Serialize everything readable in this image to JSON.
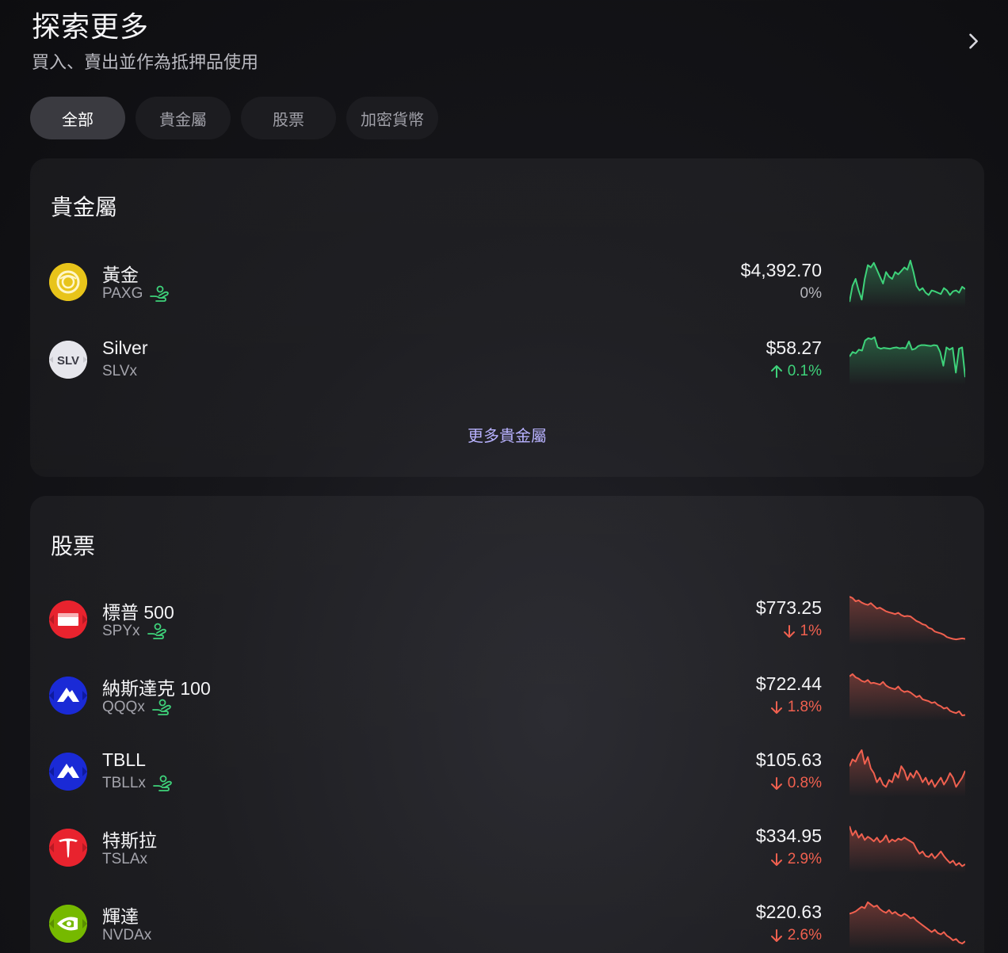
{
  "header": {
    "title": "探索更多",
    "subtitle": "買入、賣出並作為抵押品使用"
  },
  "tabs": [
    {
      "label": "全部",
      "active": true
    },
    {
      "label": "貴金屬",
      "active": false
    },
    {
      "label": "股票",
      "active": false
    },
    {
      "label": "加密貨幣",
      "active": false
    }
  ],
  "metals": {
    "title": "貴金屬",
    "more_label": "更多貴金屬",
    "items": [
      {
        "name": "黃金",
        "ticker": "PAXG",
        "lendable": true,
        "price": "$4,392.70",
        "change": "0%",
        "direction": "flat",
        "logo": "gold-coin-icon",
        "spark": [
          0.05,
          0.4,
          0.55,
          0.3,
          0.1,
          0.55,
          0.85,
          0.8,
          0.9,
          0.75,
          0.6,
          0.45,
          0.7,
          0.6,
          0.55,
          0.7,
          0.65,
          0.72,
          0.8,
          0.75,
          0.95,
          0.7,
          0.4,
          0.3,
          0.35,
          0.25,
          0.2,
          0.3,
          0.28,
          0.25,
          0.22,
          0.35,
          0.3,
          0.2,
          0.28,
          0.3,
          0.25,
          0.38,
          0.33
        ]
      },
      {
        "name": "Silver",
        "ticker": "SLVx",
        "lendable": false,
        "price": "$58.27",
        "change": "0.1%",
        "direction": "up",
        "logo": "slv-icon",
        "spark": [
          0.55,
          0.65,
          0.62,
          0.7,
          0.68,
          0.9,
          0.95,
          0.93,
          0.97,
          0.75,
          0.72,
          0.74,
          0.73,
          0.72,
          0.74,
          0.75,
          0.73,
          0.74,
          0.73,
          0.88,
          0.7,
          0.72,
          0.78,
          0.8,
          0.8,
          0.79,
          0.78,
          0.8,
          0.79,
          0.65,
          0.35,
          0.75,
          0.7,
          0.74,
          0.2,
          0.72,
          0.75,
          0.1
        ]
      }
    ]
  },
  "stocks": {
    "title": "股票",
    "items": [
      {
        "name": "標普 500",
        "ticker": "SPYx",
        "lendable": true,
        "price": "$773.25",
        "change": "1%",
        "direction": "down",
        "logo": "sp500-icon",
        "spark": [
          0.98,
          0.95,
          0.88,
          0.9,
          0.85,
          0.82,
          0.8,
          0.84,
          0.78,
          0.72,
          0.74,
          0.7,
          0.66,
          0.64,
          0.62,
          0.6,
          0.63,
          0.58,
          0.55,
          0.56,
          0.55,
          0.5,
          0.45,
          0.42,
          0.38,
          0.36,
          0.3,
          0.28,
          0.22,
          0.2,
          0.18,
          0.15,
          0.1,
          0.08,
          0.06,
          0.05,
          0.06,
          0.07,
          0.06
        ]
      },
      {
        "name": "納斯達克 100",
        "ticker": "QQQx",
        "lendable": true,
        "price": "$722.44",
        "change": "1.8%",
        "direction": "down",
        "logo": "nasdaq-icon",
        "spark": [
          0.9,
          0.95,
          0.88,
          0.85,
          0.8,
          0.78,
          0.82,
          0.75,
          0.76,
          0.74,
          0.72,
          0.78,
          0.7,
          0.66,
          0.64,
          0.62,
          0.68,
          0.6,
          0.56,
          0.58,
          0.55,
          0.5,
          0.45,
          0.48,
          0.4,
          0.38,
          0.36,
          0.32,
          0.34,
          0.28,
          0.25,
          0.2,
          0.22,
          0.15,
          0.12,
          0.1,
          0.14,
          0.05,
          0.06
        ]
      },
      {
        "name": "TBLL",
        "ticker": "TBLLx",
        "lendable": true,
        "price": "$105.63",
        "change": "0.8%",
        "direction": "down",
        "logo": "tbll-icon",
        "spark": [
          0.6,
          0.75,
          0.7,
          0.85,
          0.95,
          0.65,
          0.8,
          0.55,
          0.45,
          0.25,
          0.35,
          0.2,
          0.15,
          0.3,
          0.25,
          0.45,
          0.35,
          0.6,
          0.5,
          0.3,
          0.45,
          0.35,
          0.5,
          0.4,
          0.25,
          0.35,
          0.2,
          0.3,
          0.15,
          0.25,
          0.35,
          0.2,
          0.3,
          0.45,
          0.35,
          0.15,
          0.25,
          0.35,
          0.5
        ]
      },
      {
        "name": "特斯拉",
        "ticker": "TSLAx",
        "lendable": false,
        "price": "$334.95",
        "change": "2.9%",
        "direction": "down",
        "logo": "tesla-icon",
        "spark": [
          0.95,
          0.75,
          0.85,
          0.7,
          0.78,
          0.65,
          0.72,
          0.68,
          0.62,
          0.7,
          0.6,
          0.65,
          0.75,
          0.6,
          0.66,
          0.62,
          0.68,
          0.65,
          0.7,
          0.66,
          0.62,
          0.58,
          0.45,
          0.35,
          0.4,
          0.3,
          0.28,
          0.35,
          0.25,
          0.32,
          0.4,
          0.3,
          0.22,
          0.15,
          0.2,
          0.1,
          0.15,
          0.08,
          0.12
        ]
      },
      {
        "name": "輝達",
        "ticker": "NVDAx",
        "lendable": false,
        "price": "$220.63",
        "change": "2.6%",
        "direction": "down",
        "logo": "nvidia-icon",
        "spark": [
          0.7,
          0.72,
          0.75,
          0.8,
          0.85,
          0.82,
          0.95,
          0.9,
          0.85,
          0.88,
          0.8,
          0.75,
          0.72,
          0.78,
          0.7,
          0.74,
          0.68,
          0.65,
          0.7,
          0.66,
          0.6,
          0.62,
          0.55,
          0.5,
          0.45,
          0.4,
          0.35,
          0.3,
          0.35,
          0.28,
          0.25,
          0.3,
          0.22,
          0.18,
          0.12,
          0.15,
          0.08,
          0.05,
          0.1
        ]
      }
    ]
  },
  "colors": {
    "up": "#3ed27a",
    "down": "#f0604f",
    "accent": "#b8b2ff"
  }
}
